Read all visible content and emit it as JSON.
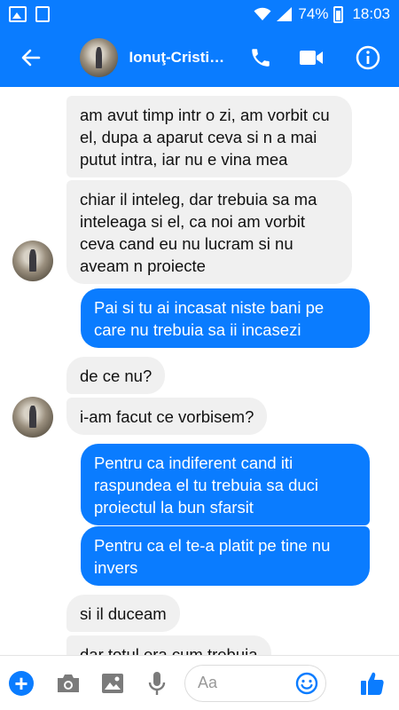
{
  "status_bar": {
    "battery": "74%",
    "time": "18:03"
  },
  "header": {
    "title": "Ionuţ-Cristi…",
    "icons": [
      "back-arrow-icon",
      "phone-icon",
      "video-camera-icon",
      "info-icon"
    ]
  },
  "messages": [
    {
      "side": "in",
      "text": "am avut timp intr o zi, am vorbit cu el, dupa a aparut ceva si n a mai putut intra, iar nu e vina mea"
    },
    {
      "side": "in",
      "text": "chiar il inteleg, dar trebuia sa ma inteleaga si el, ca noi am vorbit ceva cand eu nu lucram si nu aveam n proiecte"
    },
    {
      "side": "out",
      "text": "Pai si tu ai incasat niste bani pe care nu trebuia sa ii incasezi"
    },
    {
      "side": "in",
      "text": "de ce nu?"
    },
    {
      "side": "in",
      "text": "i-am facut ce vorbisem?"
    },
    {
      "side": "out",
      "text": "Pentru ca indiferent cand iti raspundea el tu trebuia sa duci proiectul la bun sfarsit"
    },
    {
      "side": "out",
      "text": "Pentru ca el te-a platit pe tine nu invers"
    },
    {
      "side": "in",
      "text": "si il duceam"
    },
    {
      "side": "in",
      "text": "dar totul era cum trebuia"
    }
  ],
  "composer": {
    "placeholder": "Aa"
  },
  "colors": {
    "accent": "#0a7cff",
    "incoming_bubble": "#f0f0f0"
  }
}
